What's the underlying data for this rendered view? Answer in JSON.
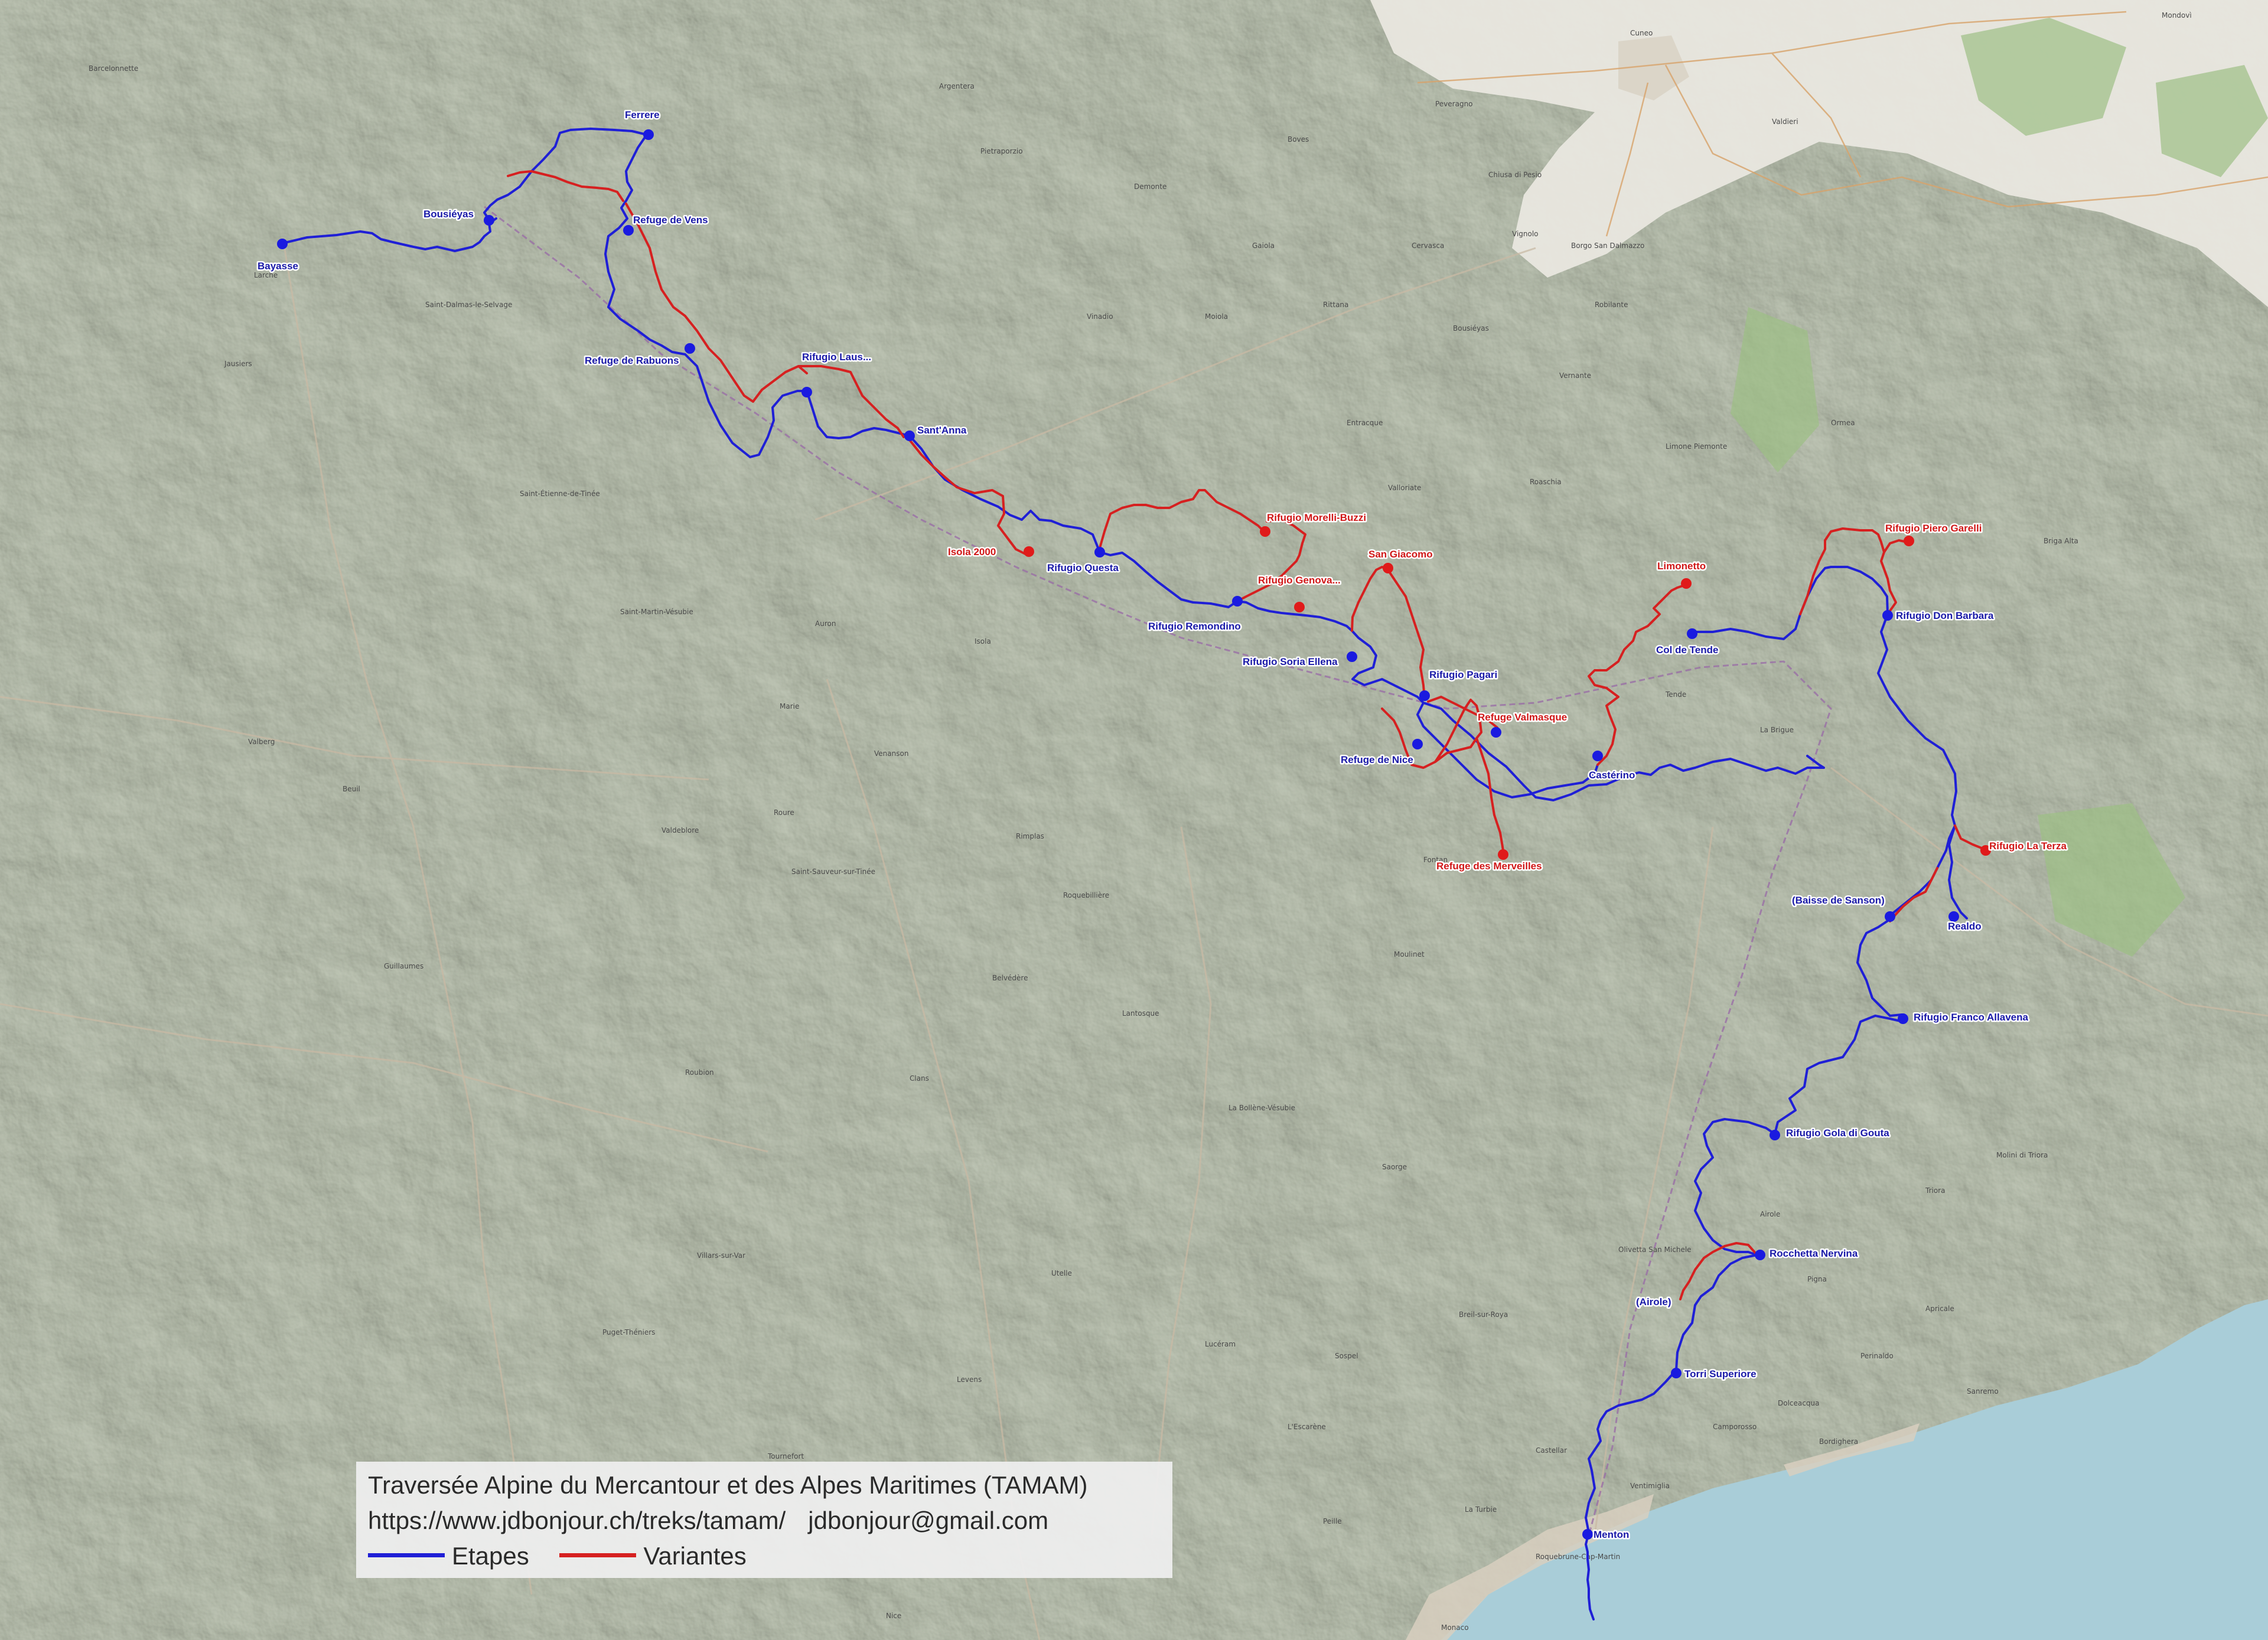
{
  "map": {
    "colors": {
      "etapes": "#1f1fd6",
      "variantes": "#d62020",
      "marker_blue": "#1a1ae0",
      "marker_red": "#e01a1a",
      "label_blue": "#1a1aa8",
      "label_red": "#d01818",
      "sea": "#a6cbd6",
      "plain": "#e8e6df",
      "forest": "#8fb27a"
    },
    "places": [
      "Barcelonnette",
      "Cuneo",
      "Borgo San Dalmazzo",
      "Mondovì",
      "Sanremo",
      "Bordighera",
      "Ventimiglia",
      "Monaco",
      "Nice",
      "Breil-sur-Roya",
      "Saint-Martin-Vésubie",
      "Valdieri",
      "Vinadio",
      "Tende",
      "La Brigue",
      "Saorge",
      "Sospel",
      "Dolceacqua",
      "Pigna",
      "Triora",
      "Limone Piemonte",
      "Entracque",
      "Roquebillière",
      "Lantosque",
      "Isola",
      "Saint-Étienne-de-Tinée",
      "Saint-Sauveur-sur-Tinée",
      "Guillaumes",
      "Beuil",
      "Valberg",
      "Auron",
      "Jausiers",
      "Larche",
      "Argentera",
      "Pietraporzio",
      "Demonte",
      "Boves",
      "Peveragno",
      "Chiusa di Pesio",
      "Ormea",
      "Briga Alta",
      "Molini di Triora",
      "Apricale",
      "Perinaldo",
      "Camporosso",
      "Airole",
      "Olivetta San Michele",
      "Castellar",
      "Roquebrune-Cap-Martin",
      "La Turbie",
      "Peille",
      "L'Escarène",
      "Lucéram",
      "Utelle",
      "Levens",
      "Tournefort",
      "Villars-sur-Var",
      "Puget-Théniers",
      "Roubion",
      "Roure",
      "Clans",
      "Valdeblore",
      "Venanson",
      "Belvédère",
      "La Bollène-Vésubie",
      "Moulinet",
      "Fontan",
      "Rimplas",
      "Marie",
      "Saint-Dalmas-le-Selvage",
      "Bousiéyas",
      "Vignolo",
      "Cervasca",
      "Rittana",
      "Gaiola",
      "Moiola",
      "Valloriate",
      "Roaschia",
      "Robilante",
      "Vernante"
    ],
    "markers": [
      {
        "name": "Ferrere",
        "type": "etape",
        "anchor": "above"
      },
      {
        "name": "Bousiéyas",
        "type": "etape",
        "anchor": "left"
      },
      {
        "name": "Refuge de Vens",
        "type": "etape",
        "anchor": "right"
      },
      {
        "name": "Bayasse",
        "type": "etape",
        "anchor": "below"
      },
      {
        "name": "Refuge de Rabuons",
        "type": "etape",
        "anchor": "left-below"
      },
      {
        "name": "Rifugio Laus...",
        "type": "etape",
        "anchor": "above"
      },
      {
        "name": "Sant'Anna",
        "type": "etape",
        "anchor": "right"
      },
      {
        "name": "Isola 2000",
        "type": "variante",
        "anchor": "left"
      },
      {
        "name": "Rifugio Questa",
        "type": "etape",
        "anchor": "below"
      },
      {
        "name": "Rifugio Morelli-Buzzi",
        "type": "variante",
        "anchor": "right"
      },
      {
        "name": "San Giacomo",
        "type": "variante",
        "anchor": "above"
      },
      {
        "name": "Rifugio Genova...",
        "type": "variante",
        "anchor": "right"
      },
      {
        "name": "Rifugio Remondino",
        "type": "etape",
        "anchor": "below"
      },
      {
        "name": "Rifugio Soria Ellena",
        "type": "etape",
        "anchor": "left"
      },
      {
        "name": "Rifugio Pagari",
        "type": "etape",
        "anchor": "right"
      },
      {
        "name": "Refuge Valmasque",
        "type": "variante",
        "anchor": "right"
      },
      {
        "name": "Refuge de Nice",
        "type": "etape",
        "anchor": "below"
      },
      {
        "name": "Refuge des Merveilles",
        "type": "variante",
        "anchor": "below"
      },
      {
        "name": "Limonetto",
        "type": "variante",
        "anchor": "above"
      },
      {
        "name": "Col de Tende",
        "type": "etape",
        "anchor": "below"
      },
      {
        "name": "Castérino",
        "type": "etape",
        "anchor": "below"
      },
      {
        "name": "Rifugio Piero Garelli",
        "type": "variante",
        "anchor": "above"
      },
      {
        "name": "Rifugio Don Barbara",
        "type": "etape",
        "anchor": "right"
      },
      {
        "name": "Rifugio La Terza",
        "type": "variante",
        "anchor": "right"
      },
      {
        "name": "(Baisse de Sanson)",
        "type": "etape",
        "anchor": "above"
      },
      {
        "name": "Realdo",
        "type": "etape",
        "anchor": "below"
      },
      {
        "name": "Rifugio Franco Allavena",
        "type": "etape",
        "anchor": "right"
      },
      {
        "name": "Rifugio Gola di Gouta",
        "type": "etape",
        "anchor": "right"
      },
      {
        "name": "Rocchetta Nervina",
        "type": "etape",
        "anchor": "right"
      },
      {
        "name": "(Airole)",
        "type": "etape",
        "anchor": "above"
      },
      {
        "name": "Torri Superiore",
        "type": "etape",
        "anchor": "right"
      },
      {
        "name": "Menton",
        "type": "etape",
        "anchor": "right"
      }
    ]
  },
  "legend": {
    "title": "Traversée Alpine du Mercantour et des Alpes Maritimes (TAMAM)",
    "url": "https://www.jdbonjour.ch/treks/tamam/",
    "email": "jdbonjour@gmail.com",
    "etapes_label": "Etapes",
    "variantes_label": "Variantes"
  }
}
